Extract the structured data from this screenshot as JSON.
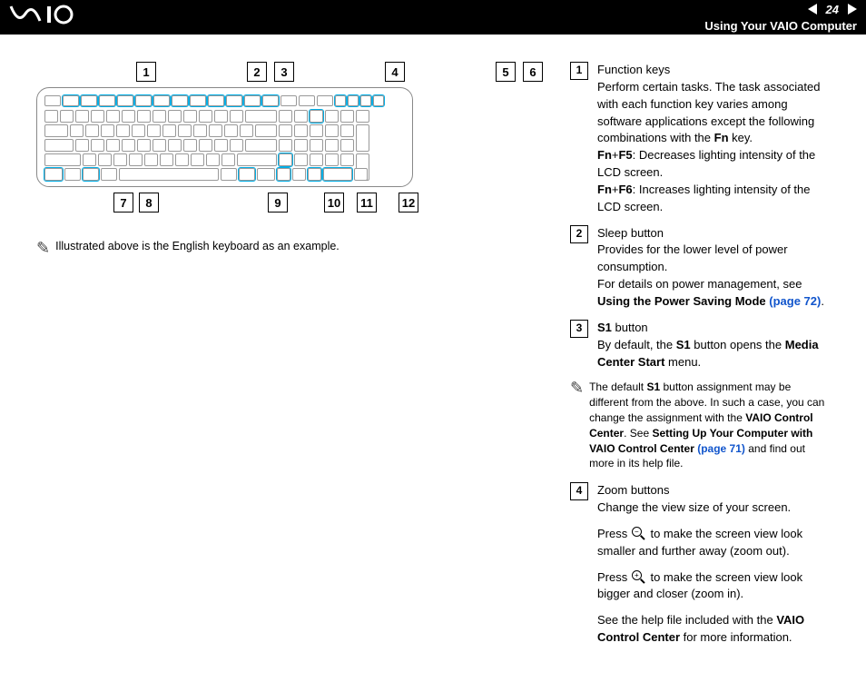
{
  "header": {
    "logo": "\\/\\IO",
    "page_number": "24",
    "section_title": "Using Your VAIO Computer"
  },
  "left": {
    "top_callouts_group1": [
      "1"
    ],
    "top_callouts_group2": [
      "2",
      "3"
    ],
    "top_callouts_group3": [
      "4"
    ],
    "top_callouts_group4": [
      "5",
      "6"
    ],
    "bottom_callouts": [
      "7",
      "8",
      "9",
      "10",
      "11",
      "12"
    ],
    "note_text": "Illustrated above is the English keyboard as an example."
  },
  "items": {
    "i1": {
      "num": "1",
      "title": "Function keys",
      "line1": "Perform certain tasks. The task associated with each function key varies among software applications except the following combinations with the ",
      "fn": "Fn",
      "line1_end": " key.",
      "fnf5_label": "Fn",
      "plus1": "+",
      "f5": "F5",
      "fnf5_desc": ": Decreases lighting intensity of the LCD screen.",
      "fnf6_label": "Fn",
      "plus2": "+",
      "f6": "F6",
      "fnf6_desc": ": Increases lighting intensity of the LCD screen."
    },
    "i2": {
      "num": "2",
      "title": "Sleep button",
      "line1": "Provides for the lower level of power consumption.",
      "line2_pre": "For details on power management, see ",
      "line2_bold": "Using the Power Saving Mode ",
      "line2_link": "(page 72)",
      "line2_end": "."
    },
    "i3": {
      "num": "3",
      "title_bold": "S1",
      "title_rest": " button",
      "line1_pre": "By default, the ",
      "line1_bold1": "S1",
      "line1_mid": " button opens the ",
      "line1_bold2": "Media Center Start",
      "line1_end": " menu."
    },
    "note2": {
      "pre": "The default ",
      "b1": "S1",
      "mid1": " button assignment may be different from the above. In such a case, you can change the assignment with the ",
      "b2": "VAIO Control Center",
      "mid2": ". See ",
      "b3": "Setting Up Your Computer with VAIO Control Center ",
      "link": "(page 71)",
      "end": " and find out more in its help file."
    },
    "i4": {
      "num": "4",
      "title": "Zoom buttons",
      "line1": "Change the view size of your screen.",
      "zoom_out_pre": "Press ",
      "zoom_out_post": " to make the screen view look smaller and further away (zoom out).",
      "zoom_in_pre": "Press ",
      "zoom_in_post": " to make the screen view look bigger and closer (zoom in).",
      "help_pre": "See the help file included with the ",
      "help_bold": "VAIO Control Center",
      "help_end": " for more information."
    }
  }
}
